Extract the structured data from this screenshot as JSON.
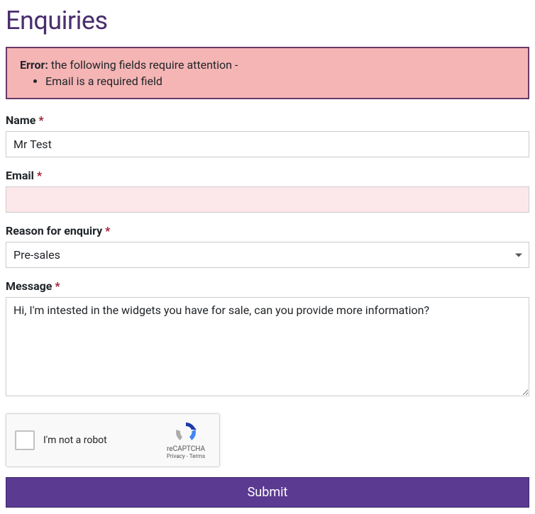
{
  "page": {
    "title": "Enquiries"
  },
  "error": {
    "prefix": "Error:",
    "message": "the following fields require attention -",
    "items": [
      "Email is a required field"
    ]
  },
  "form": {
    "name": {
      "label": "Name",
      "value": "Mr Test"
    },
    "email": {
      "label": "Email",
      "value": ""
    },
    "reason": {
      "label": "Reason for enquiry",
      "selected": "Pre-sales"
    },
    "message": {
      "label": "Message",
      "value": "Hi, I'm intested in the widgets you have for sale, can you provide more information?"
    },
    "required_marker": "*"
  },
  "recaptcha": {
    "label": "I'm not a robot",
    "brand": "reCAPTCHA",
    "privacy": "Privacy",
    "terms": "Terms",
    "separator": " - "
  },
  "submit": {
    "label": "Submit"
  }
}
